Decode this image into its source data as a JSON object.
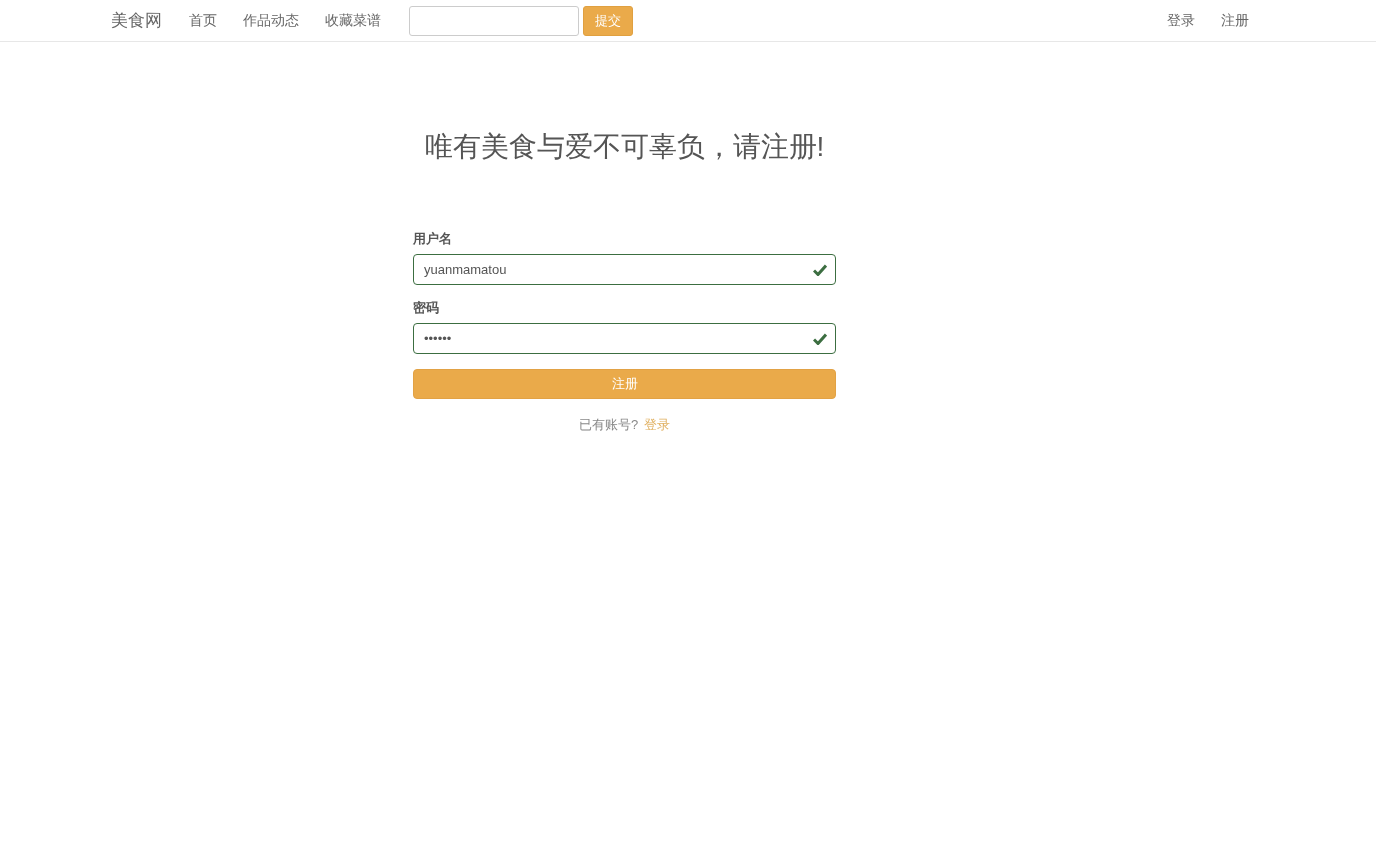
{
  "navbar": {
    "brand": "美食网",
    "links": [
      {
        "label": "首页"
      },
      {
        "label": "作品动态"
      },
      {
        "label": "收藏菜谱"
      }
    ],
    "search": {
      "button": "提交"
    },
    "right_links": [
      {
        "label": "登录"
      },
      {
        "label": "注册"
      }
    ]
  },
  "heading": "唯有美食与爱不可辜负，请注册!",
  "form": {
    "fields": [
      {
        "label": "用户名",
        "value": "yuanmamatou",
        "valid": true
      },
      {
        "label": "密码",
        "value": "••••••",
        "valid": true
      }
    ],
    "submit": "注册",
    "footer": {
      "text": "已有账号?",
      "link": "登录"
    }
  }
}
